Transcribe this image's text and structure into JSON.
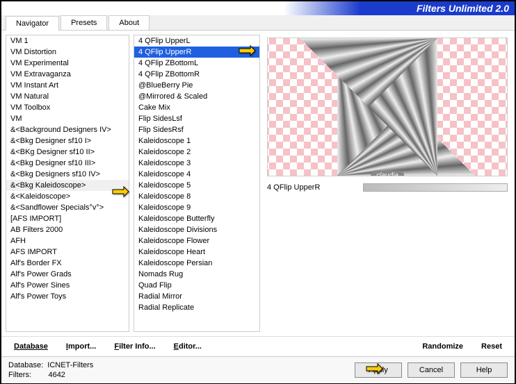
{
  "header": {
    "title": "Filters Unlimited 2.0"
  },
  "tabs": {
    "items": [
      "Navigator",
      "Presets",
      "About"
    ],
    "active": 0
  },
  "leftList": {
    "selectedIndex": 13,
    "items": [
      "VM 1",
      "VM Distortion",
      "VM Experimental",
      "VM Extravaganza",
      "VM Instant Art",
      "VM Natural",
      "VM Toolbox",
      "VM",
      "&<Background Designers IV>",
      "&<Bkg Designer sf10 I>",
      "&<BKg Designer sf10 II>",
      "&<Bkg Designer sf10 III>",
      "&<Bkg Designers sf10 IV>",
      "&<Bkg Kaleidoscope>",
      "&<Kaleidoscope>",
      "&<Sandflower Specials°v°>",
      "[AFS IMPORT]",
      "AB Filters 2000",
      "AFH",
      "AFS IMPORT",
      "Alf's Border FX",
      "Alf's Power Grads",
      "Alf's Power Sines",
      "Alf's Power Toys"
    ]
  },
  "rightList": {
    "selectedIndex": 1,
    "items": [
      "4 QFlip UpperL",
      "4 QFlip UpperR",
      "4 QFlip ZBottomL",
      "4 QFlip ZBottomR",
      "@BlueBerry Pie",
      "@Mirrored & Scaled",
      "Cake Mix",
      "Flip SidesLsf",
      "Flip SidesRsf",
      "Kaleidoscope 1",
      "Kaleidoscope 2",
      "Kaleidoscope 3",
      "Kaleidoscope 4",
      "Kaleidoscope 5",
      "Kaleidoscope 8",
      "Kaleidoscope 9",
      "Kaleidoscope Butterfly",
      "Kaleidoscope Divisions",
      "Kaleidoscope Flower",
      "Kaleidoscope Heart",
      "Kaleidoscope Persian",
      "Nomads Rug",
      "Quad Flip",
      "Radial Mirror",
      "Radial Replicate"
    ]
  },
  "preview": {
    "watermark": "claudia",
    "paramLabel": "4 QFlip UpperR"
  },
  "buttons1": {
    "database": "Database",
    "import": "Import...",
    "filterInfo": "Filter Info...",
    "editor": "Editor...",
    "randomize": "Randomize",
    "reset": "Reset"
  },
  "status": {
    "dbLabel": "Database:",
    "dbValue": "ICNET-Filters",
    "filtersLabel": "Filters:",
    "filtersValue": "4642"
  },
  "footerButtons": {
    "apply": "Apply",
    "cancel": "Cancel",
    "help": "Help"
  }
}
